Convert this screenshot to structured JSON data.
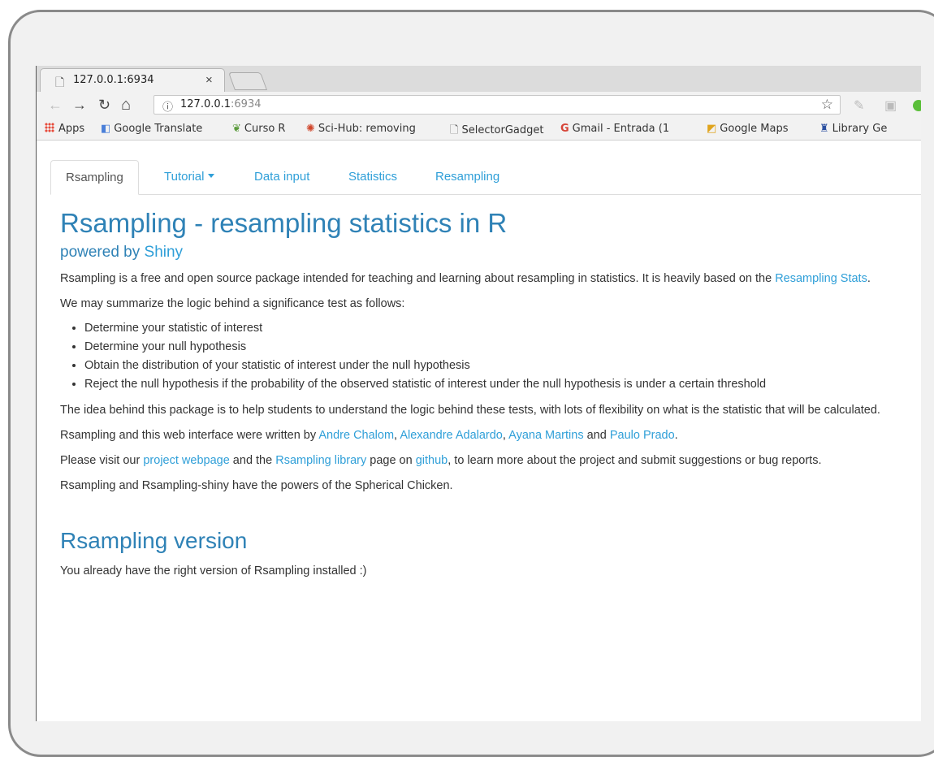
{
  "browser": {
    "tab_title": "127.0.0.1:6934",
    "tab_close": "×",
    "url_host": "127.0.0.1",
    "url_port": ":6934"
  },
  "bookmarks": [
    {
      "label": "Apps",
      "icon": "apps-grid-icon"
    },
    {
      "label": "Google Translate",
      "icon": "translate-icon"
    },
    {
      "label": "Curso R",
      "icon": "curso-r-icon"
    },
    {
      "label": "Sci-Hub: removing",
      "icon": "sci-hub-icon"
    },
    {
      "label": "SelectorGadget",
      "icon": "page-icon"
    },
    {
      "label": "Gmail - Entrada (1",
      "icon": "google-g-icon"
    },
    {
      "label": "Google Maps",
      "icon": "maps-icon"
    },
    {
      "label": "Library Ge",
      "icon": "library-icon"
    }
  ],
  "nav": {
    "active": "Rsampling",
    "tutorial": "Tutorial",
    "data_input": "Data input",
    "statistics": "Statistics",
    "resampling": "Resampling"
  },
  "page": {
    "title": "Rsampling - resampling statistics in R",
    "subtitle_prefix": "powered by ",
    "subtitle_link": "Shiny",
    "intro_text": "Rsampling is a free and open source package intended for teaching and learning about resampling in statistics. It is heavily based on the ",
    "intro_link": "Resampling Stats",
    "intro_end": ".",
    "summary_lead": "We may summarize the logic behind a significance test as follows:",
    "steps": [
      "Determine your statistic of interest",
      "Determine your null hypothesis",
      "Obtain the distribution of your statistic of interest under the null hypothesis",
      "Reject the null hypothesis if the probability of the observed statistic of interest under the null hypothesis is under a certain threshold"
    ],
    "idea": "The idea behind this package is to help students to understand the logic behind these tests, with lots of flexibility on what is the statistic that will be calculated.",
    "authors_lead": "Rsampling and this web interface were written by ",
    "authors": [
      "Andre Chalom",
      "Alexandre Adalardo",
      "Ayana Martins",
      "Paulo Prado"
    ],
    "visit_a": "Please visit our ",
    "visit_link1": "project webpage",
    "visit_b": " and the ",
    "visit_link2": "Rsampling library",
    "visit_c": " page on ",
    "visit_link3": "github",
    "visit_d": ", to learn more about the project and submit suggestions or bug reports.",
    "chicken": "Rsampling and Rsampling-shiny have the powers of the Spherical Chicken.",
    "version_heading": "Rsampling version",
    "version_text": "You already have the right version of Rsampling installed :)"
  },
  "colors": {
    "link": "#2f9fd8",
    "heading": "#2f82b6"
  }
}
